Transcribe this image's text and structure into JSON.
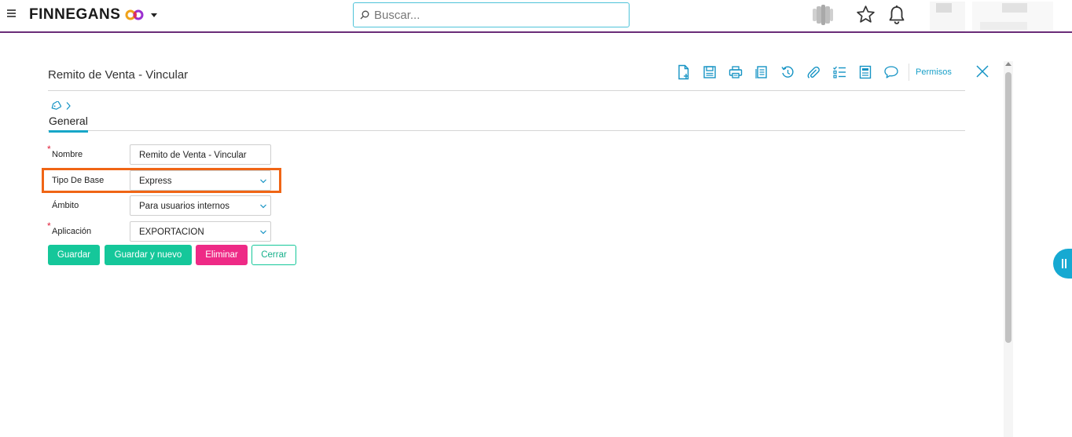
{
  "app": {
    "brand_name": "FINNEGANS",
    "search_placeholder": "Buscar..."
  },
  "panel": {
    "title": "Remito de Venta - Vincular",
    "permisos_label": "Permisos",
    "tab_general": "General"
  },
  "toolbar": {
    "icons": [
      "new-document-icon",
      "save-icon",
      "print-icon",
      "copy-icon",
      "history-icon",
      "attach-icon",
      "checklist-icon",
      "form-icon",
      "comment-icon"
    ]
  },
  "form": {
    "nombre": {
      "label": "Nombre",
      "value": "Remito de Venta - Vincular",
      "required": true
    },
    "tipo_base": {
      "label": "Tipo De Base",
      "value": "Express",
      "required": false
    },
    "ambito": {
      "label": "Ámbito",
      "value": "Para usuarios internos",
      "required": false
    },
    "aplicacion": {
      "label": "Aplicación",
      "value": "EXPORTACION",
      "required": true
    }
  },
  "buttons": {
    "guardar": "Guardar",
    "guardar_nuevo": "Guardar y nuevo",
    "eliminar": "Eliminar",
    "cerrar": "Cerrar"
  },
  "colors": {
    "accent": "#16a9d2",
    "topbar_rule": "#6a2c78",
    "green": "#15c79a",
    "pink": "#ee2a86",
    "highlight": "#f06515",
    "required": "#e0203a"
  }
}
